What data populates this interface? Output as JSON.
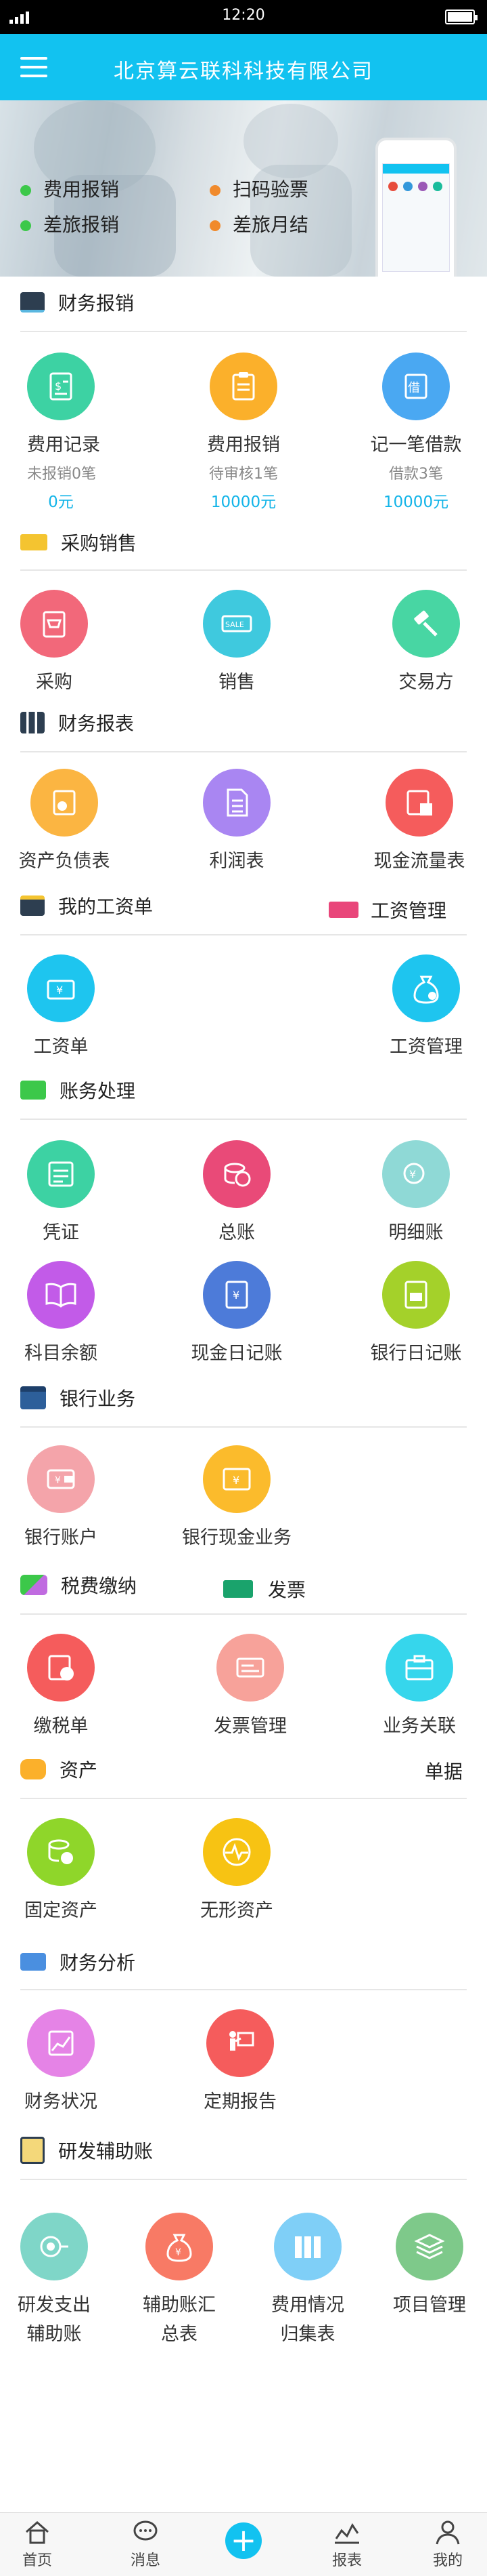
{
  "status": {
    "time": "12:20"
  },
  "header": {
    "title": "北京算云联科科技有限公司"
  },
  "banner": {
    "items": [
      {
        "label": "费用报销",
        "color": "#3cc84a"
      },
      {
        "label": "扫码验票",
        "color": "#f08a2c"
      },
      {
        "label": "差旅报销",
        "color": "#3cc84a"
      },
      {
        "label": "差旅月结",
        "color": "#f08a2c"
      }
    ]
  },
  "sections": {
    "finance_expense": {
      "title": "财务报销",
      "items": [
        {
          "label": "费用记录",
          "sub1": "未报销0笔",
          "sub2": "0元"
        },
        {
          "label": "费用报销",
          "sub1": "待审核1笔",
          "sub2": "10000元"
        },
        {
          "label": "记一笔借款",
          "sub1": "借款3笔",
          "sub2": "10000元"
        }
      ]
    },
    "purchase_sales": {
      "title": "采购销售",
      "items": [
        {
          "label": "采购"
        },
        {
          "label": "销售"
        },
        {
          "label": "交易方"
        }
      ]
    },
    "finance_reports": {
      "title": "财务报表",
      "items": [
        {
          "label": "资产负债表"
        },
        {
          "label": "利润表"
        },
        {
          "label": "现金流量表"
        }
      ]
    },
    "payroll": {
      "title": "我的工资单",
      "title_right": "工资管理",
      "items": [
        {
          "label": "工资单"
        },
        {
          "label": "工资管理"
        }
      ]
    },
    "accounting": {
      "title": "账务处理",
      "items": [
        {
          "label": "凭证"
        },
        {
          "label": "总账"
        },
        {
          "label": "明细账"
        },
        {
          "label": "科目余额"
        },
        {
          "label": "现金日记账"
        },
        {
          "label": "银行日记账"
        }
      ]
    },
    "banking": {
      "title": "银行业务",
      "items": [
        {
          "label": "银行账户"
        },
        {
          "label": "银行现金业务"
        }
      ]
    },
    "tax": {
      "title": "税费缴纳",
      "title_right": "发票",
      "items": [
        {
          "label": "缴税单"
        },
        {
          "label": "发票管理"
        },
        {
          "label": "业务关联"
        }
      ]
    },
    "assets": {
      "title": "资产",
      "title_right": "单据",
      "items": [
        {
          "label": "固定资产"
        },
        {
          "label": "无形资产"
        }
      ]
    },
    "analysis": {
      "title": "财务分析",
      "items": [
        {
          "label": "财务状况"
        },
        {
          "label": "定期报告"
        }
      ]
    },
    "rnd": {
      "title": "研发辅助账",
      "items": [
        {
          "label1": "研发支出",
          "label2": "辅助账"
        },
        {
          "label1": "辅助账汇",
          "label2": "总表"
        },
        {
          "label1": "费用情况",
          "label2": "归集表"
        },
        {
          "label1": "项目管理",
          "label2": ""
        }
      ]
    }
  },
  "tabbar": {
    "items": [
      {
        "label": "首页",
        "icon": "home-icon"
      },
      {
        "label": "消息",
        "icon": "message-icon"
      },
      {
        "label": "+",
        "icon": "plus-icon"
      },
      {
        "label": "报表",
        "icon": "chart-icon"
      },
      {
        "label": "我的",
        "icon": "user-icon"
      }
    ]
  },
  "colors": {
    "accent": "#12c2f0",
    "green": "#3cc84a",
    "orange": "#f08a2c"
  }
}
